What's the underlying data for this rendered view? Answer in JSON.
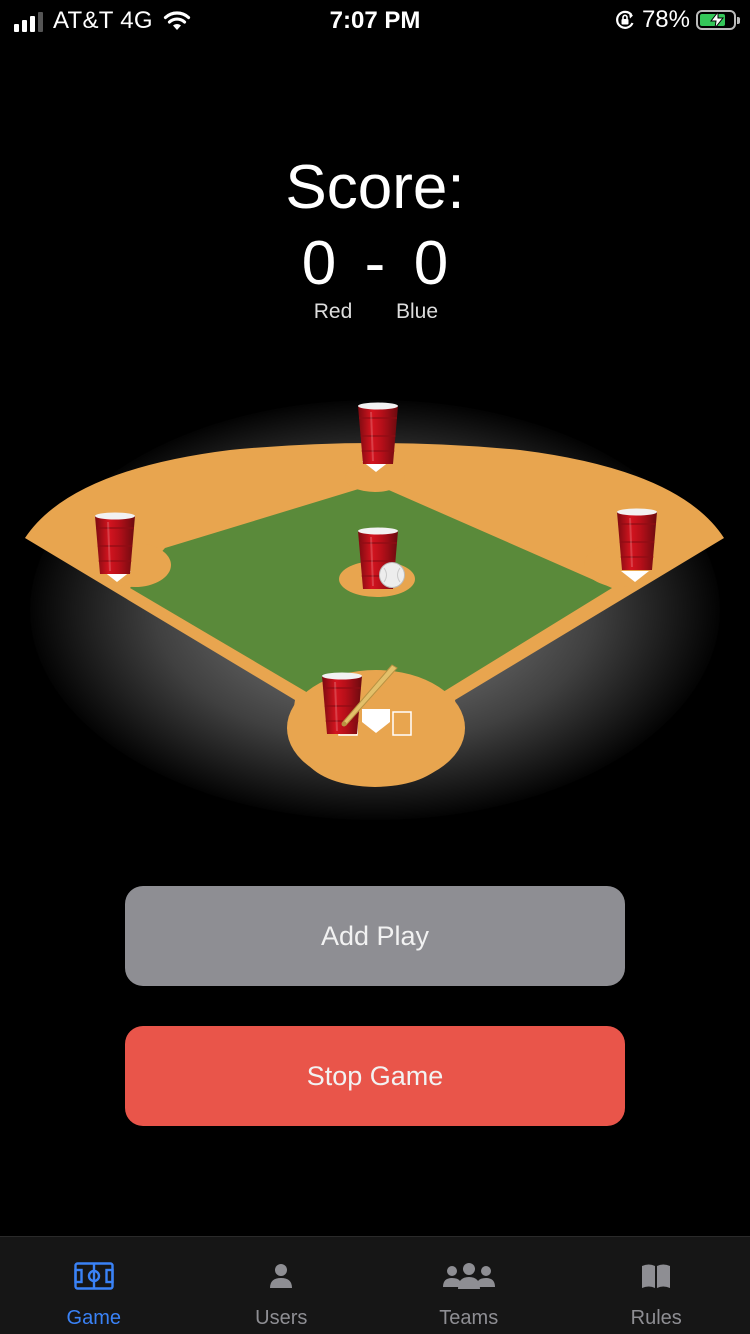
{
  "status_bar": {
    "carrier": "AT&T 4G",
    "time": "7:07 PM",
    "battery_percent": "78%",
    "battery_level": 0.78,
    "icons": [
      "signal-icon",
      "wifi-icon",
      "orientation-lock-icon",
      "battery-charging-icon"
    ]
  },
  "score": {
    "title": "Score:",
    "red_score": "0",
    "separator": "-",
    "blue_score": "0",
    "red_label": "Red",
    "blue_label": "Blue"
  },
  "field": {
    "icons": [
      "red-cup-icon",
      "baseball-icon",
      "bat-icon",
      "home-plate-icon"
    ],
    "colors": {
      "infield_dirt": "#e8a54f",
      "grass": "#5a8a3a",
      "cup_red": "#c8121e"
    }
  },
  "buttons": {
    "add_play": "Add Play",
    "stop_game": "Stop Game"
  },
  "tab_bar": {
    "active_color": "#3a82f6",
    "inactive_color": "#8e8e93",
    "tabs": [
      {
        "label": "Game",
        "icon": "field-icon",
        "active": true
      },
      {
        "label": "Users",
        "icon": "person-icon",
        "active": false
      },
      {
        "label": "Teams",
        "icon": "people-icon",
        "active": false
      },
      {
        "label": "Rules",
        "icon": "book-icon",
        "active": false
      }
    ]
  }
}
